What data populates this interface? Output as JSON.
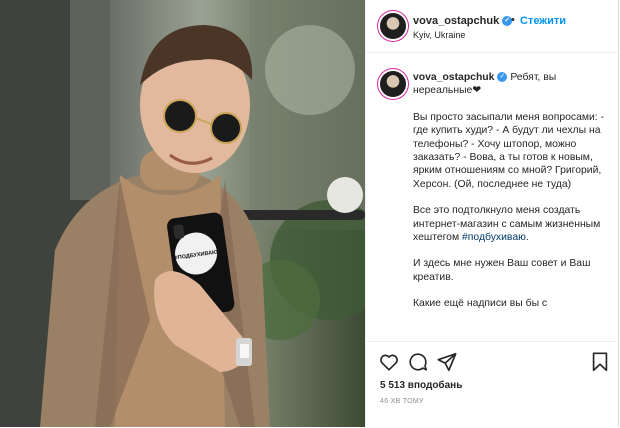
{
  "post": {
    "username": "vova_ostapchuk",
    "follow_label": "Стежити",
    "separator": "•",
    "location": "Kyiv, Ukraine",
    "phone_sticker_text": "#ПОДБУХИВАЮ",
    "caption": {
      "first_line": "Ребят, вы нереальные❤",
      "paragraph_1": "Вы просто засыпали меня вопросами: - где купить худи? - А будут ли чехлы на телефоны? - Хочу штопор, можно заказать? - Вова, а ты готов к новым, ярким отношениям со мной? Григорий, Херсон. (Ой, последнее не туда)",
      "paragraph_2_text": "Все это подтолкнуло меня создать интернет-магазин с самым жизненным хештегом ",
      "hashtag": "#подбухиваю",
      "paragraph_2_end": ".",
      "paragraph_3": "И здесь мне нужен Ваш совет и Ваш креатив.",
      "paragraph_4": "Какие ещё надписи вы бы с"
    },
    "likes": "5 513 вподобань",
    "time": "46 ХВ ТОМУ"
  },
  "colors": {
    "accent": "#0095f6",
    "verified": "#3897f0",
    "hashtag": "#00376b",
    "muted": "#8e8e8e"
  },
  "icons": [
    "verified-badge-icon",
    "heart-icon",
    "comment-icon",
    "share-icon",
    "bookmark-icon"
  ]
}
